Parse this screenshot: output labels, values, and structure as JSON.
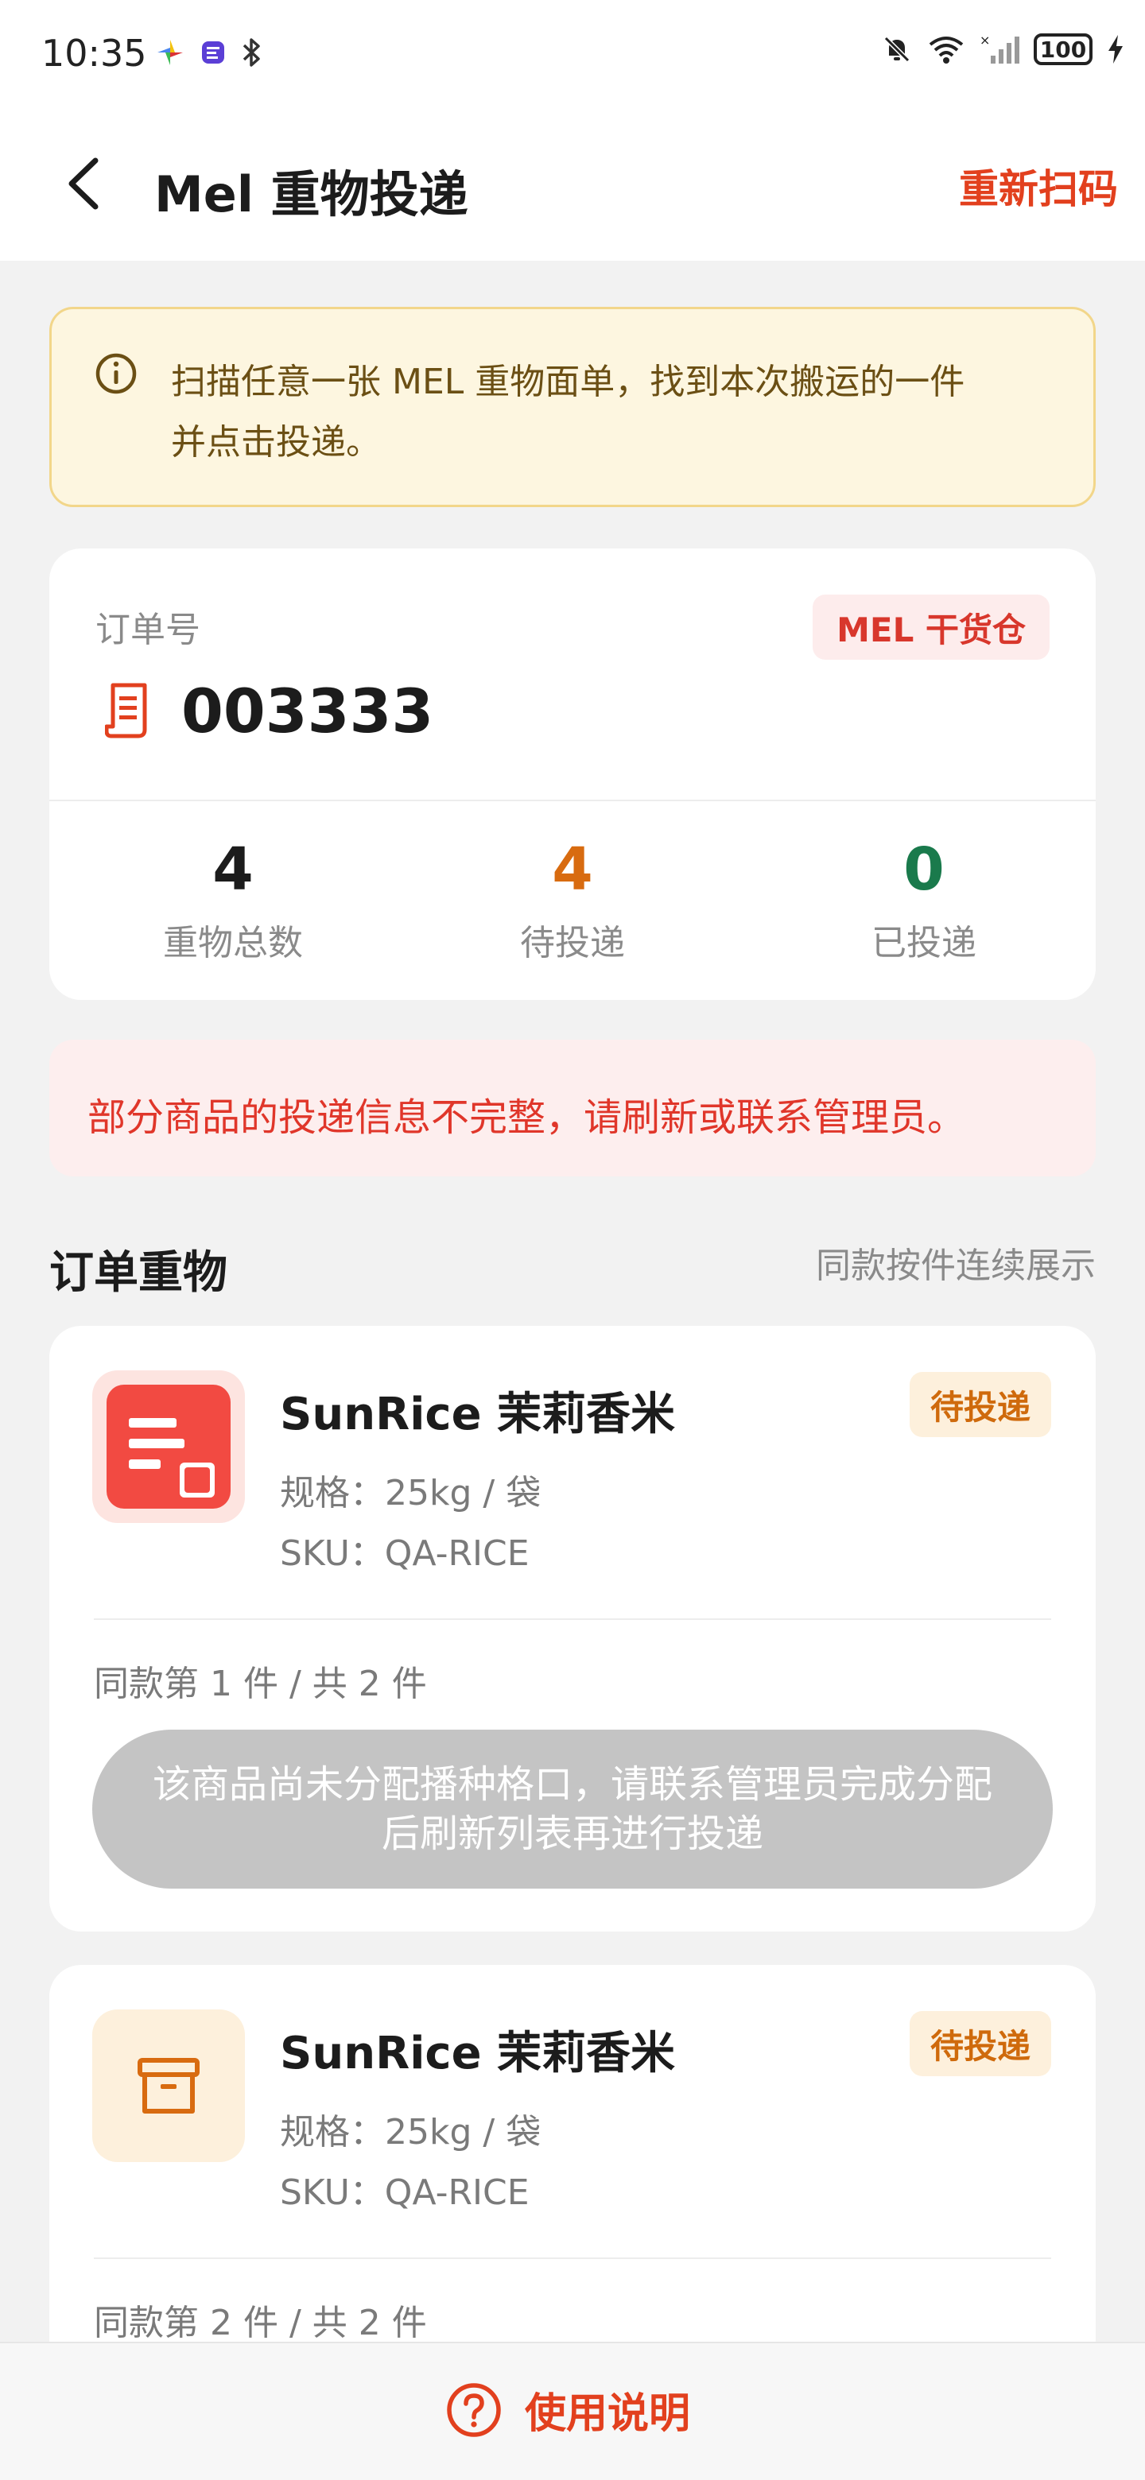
{
  "status_bar": {
    "time": "10:35",
    "battery": "100",
    "icons_left": [
      "app-pinwheel-icon",
      "app-sticker-icon",
      "bluetooth-icon"
    ],
    "icons_right": [
      "bell-muted-icon",
      "wifi-icon",
      "signal-icon",
      "battery-icon",
      "charging-icon"
    ]
  },
  "header": {
    "title": "Mel 重物投递",
    "rescan_label": "重新扫码"
  },
  "notice": {
    "line1": "扫描任意一张 MEL 重物面单，找到本次搬运的一件",
    "line2": "并点击投递。"
  },
  "order": {
    "label": "订单号",
    "number": "003333",
    "warehouse": "MEL 干货仓",
    "stats": [
      {
        "value": "4",
        "label": "重物总数",
        "color": "#1c1c1c"
      },
      {
        "value": "4",
        "label": "待投递",
        "color": "#d86b10"
      },
      {
        "value": "0",
        "label": "已投递",
        "color": "#1a7a4c"
      }
    ]
  },
  "error": {
    "text": "部分商品的投递信息不完整，请刷新或联系管理员。"
  },
  "section": {
    "title": "订单重物",
    "hint": "同款按件连续展示"
  },
  "items": [
    {
      "name": "SunRice 茉莉香米",
      "status": "待投递",
      "spec": "规格：25kg / 袋",
      "sku": "SKU：QA-RICE",
      "seq": "同款第 1 件 / 共 2 件",
      "action": "该商品尚未分配播种格口，请联系管理员完成分配后刷新列表再进行投递"
    },
    {
      "name": "SunRice 茉莉香米",
      "status": "待投递",
      "spec": "规格：25kg / 袋",
      "sku": "SKU：QA-RICE",
      "seq": "同款第 2 件 / 共 2 件"
    }
  ],
  "footer": {
    "help_label": "使用说明"
  },
  "colors": {
    "accent": "#e2401e",
    "pending": "#d86b10",
    "done": "#1a7a4c",
    "notice_bg": "#fdf6e0",
    "error_bg": "#fdeeee"
  }
}
